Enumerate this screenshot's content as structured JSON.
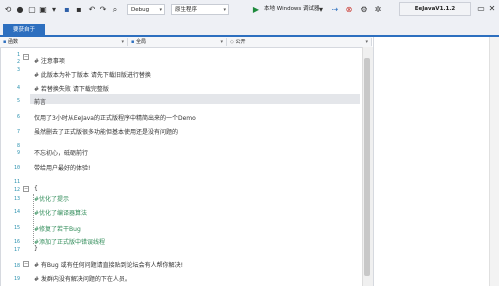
{
  "toolbar": {
    "config_select": "Debug",
    "platform_select": "原生程序",
    "run_label": "本地 Windows 调试器",
    "title": "EeJavaV1.1.2"
  },
  "tabs": [
    {
      "label": "要获自于"
    }
  ],
  "navbar": {
    "scope": "函数",
    "object": "全局",
    "member": "公开"
  },
  "editor": {
    "lines": [
      {
        "n": "1",
        "text": ""
      },
      {
        "n": "2",
        "text": "# 注意事项"
      },
      {
        "n": "3",
        "text": "# 此版本为补丁版本 请先下载旧版进行替换"
      },
      {
        "n": "4",
        "text": "# 若替换失败 请下载完整版"
      },
      {
        "n": "5",
        "text": "前言"
      },
      {
        "n": "6",
        "text": "仅用了3小时从EeJava的正式版程序中精简出来的一个Demo"
      },
      {
        "n": "7",
        "text": "虽然删去了正式版很多功能但基本使用还是没有问题的"
      },
      {
        "n": "8",
        "text": ""
      },
      {
        "n": "9",
        "text": "不忘初心，砥砺前行"
      },
      {
        "n": "10",
        "text": "带给用户最好的体验!"
      },
      {
        "n": "11",
        "text": ""
      },
      {
        "n": "12",
        "text": "{"
      },
      {
        "n": "13",
        "text": "#优化了提示"
      },
      {
        "n": "14",
        "text": "#优化了编译器算法"
      },
      {
        "n": "15",
        "text": "#修复了若干Bug"
      },
      {
        "n": "16",
        "text": "#添加了正式版中错误线程"
      },
      {
        "n": "17",
        "text": "}"
      },
      {
        "n": "18",
        "text": "# 有Bug 或有任何问题请直接贴到论坛会有人帮你解决!"
      },
      {
        "n": "19",
        "text": "# 发群内没有解决问题的下在人员。"
      }
    ]
  }
}
